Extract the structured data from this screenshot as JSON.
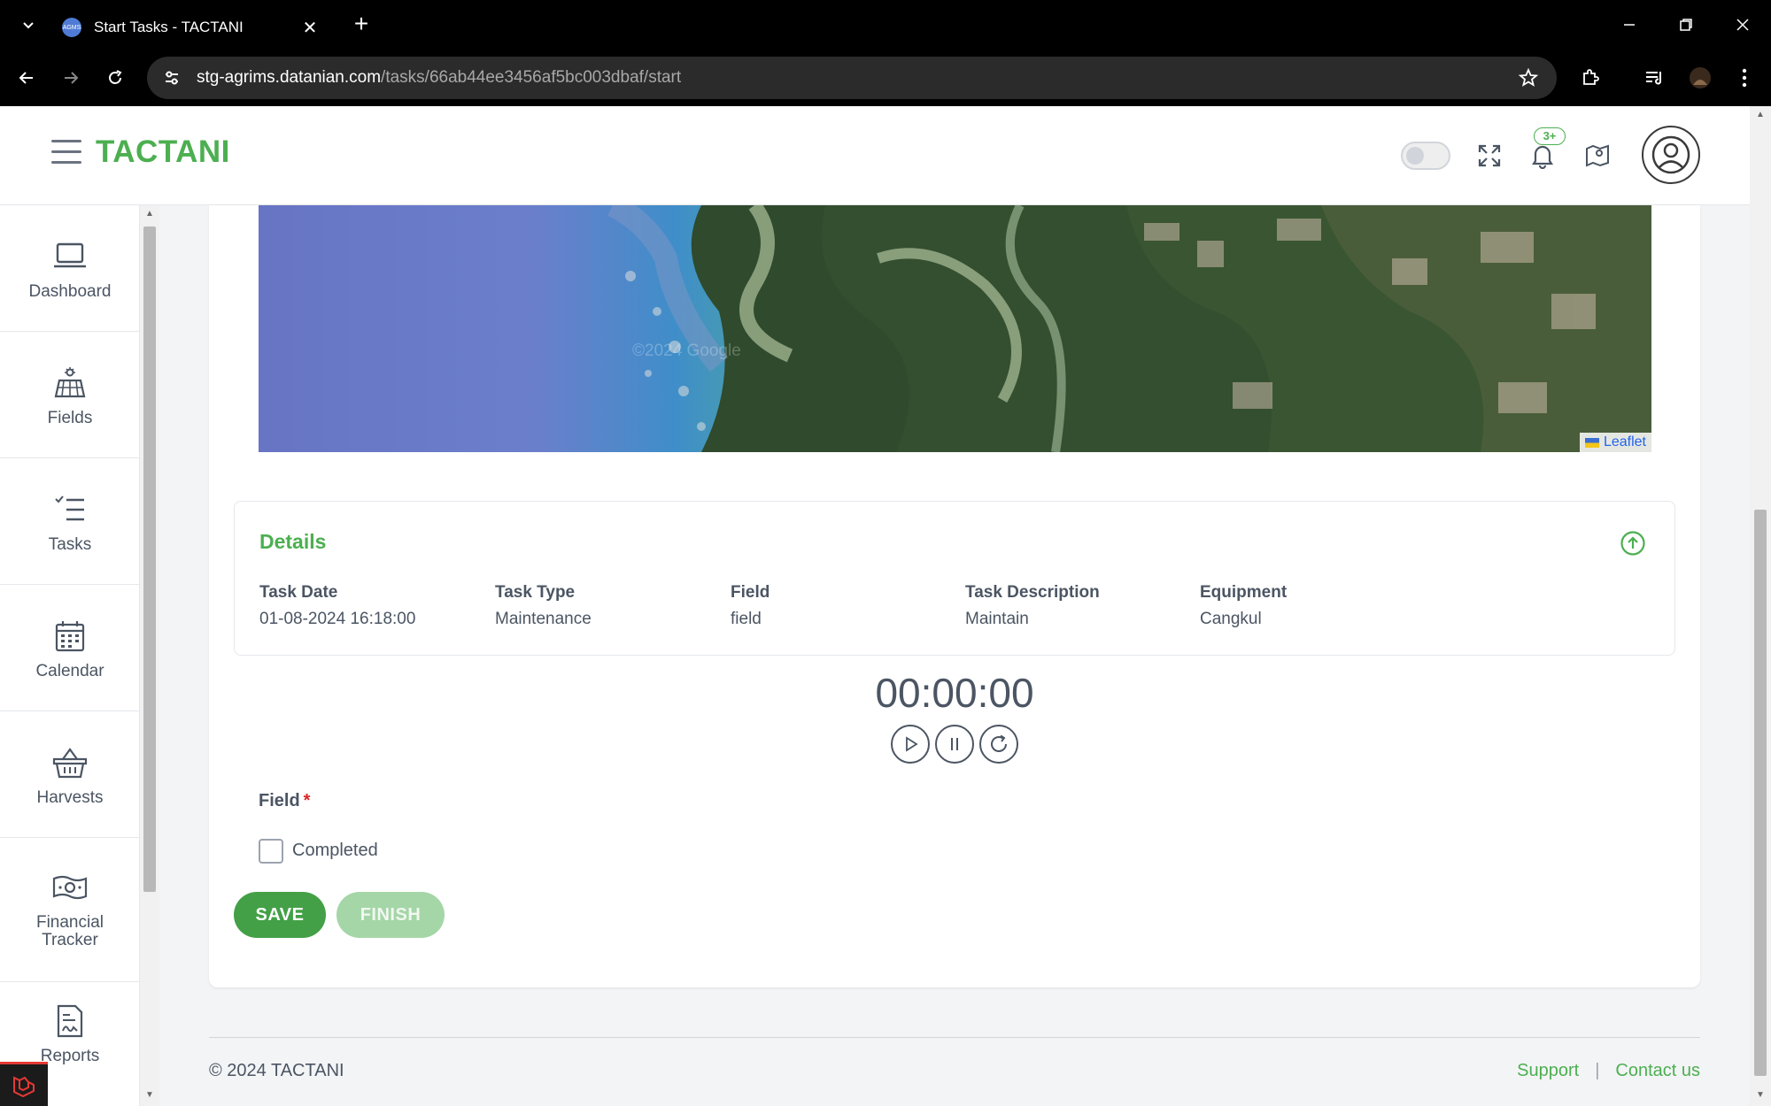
{
  "browser": {
    "tab_title": "Start Tasks - TACTANI",
    "favicon_text": "AGMS",
    "url_host": "stg-agrims.datanian.com",
    "url_path": "/tasks/66ab44ee3456af5bc003dbaf/start"
  },
  "header": {
    "brand": "TACTANI",
    "notification_count": "3+"
  },
  "sidebar": {
    "items": [
      {
        "label": "Dashboard",
        "icon": "laptop-icon"
      },
      {
        "label": "Fields",
        "icon": "field-icon"
      },
      {
        "label": "Tasks",
        "icon": "task-list-icon"
      },
      {
        "label": "Calendar",
        "icon": "calendar-icon"
      },
      {
        "label": "Harvests",
        "icon": "basket-icon"
      },
      {
        "label": "Financial Tracker",
        "icon": "money-icon"
      },
      {
        "label": "Reports",
        "icon": "report-icon"
      }
    ]
  },
  "map": {
    "attribution": "Leaflet",
    "watermark": "©2024 Google"
  },
  "details": {
    "title": "Details",
    "columns": [
      {
        "header": "Task Date",
        "value": "01-08-2024 16:18:00"
      },
      {
        "header": "Task Type",
        "value": "Maintenance"
      },
      {
        "header": "Field",
        "value": "field"
      },
      {
        "header": "Task Description",
        "value": "Maintain"
      },
      {
        "header": "Equipment",
        "value": "Cangkul"
      }
    ]
  },
  "timer": {
    "display": "00:00:00"
  },
  "form": {
    "field_label": "Field",
    "required_mark": "*",
    "checkbox_label": "Completed",
    "checkbox_checked": false
  },
  "actions": {
    "save_label": "SAVE",
    "finish_label": "FINISH"
  },
  "footer": {
    "copyright": "© 2024 TACTANI",
    "support_label": "Support",
    "separator": "|",
    "contact_label": "Contact us"
  },
  "colors": {
    "brand_green": "#4caf50",
    "save_green": "#43a047",
    "finish_disabled": "#a5d6a7"
  }
}
